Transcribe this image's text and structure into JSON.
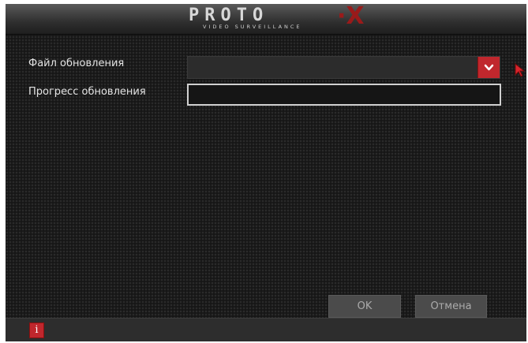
{
  "header": {
    "logo_text": "PROTO",
    "logo_sub": "VIDEO SURVEILLANCE",
    "logo_mark": "·X"
  },
  "form": {
    "update_file_label": "Файл обновления",
    "update_file_value": "",
    "update_progress_label": "Прогресс обновления",
    "update_progress_value": 0
  },
  "buttons": {
    "ok_label": "OK",
    "cancel_label": "Отмена"
  },
  "icons": {
    "dropdown": "chevron-down-icon",
    "cursor": "mouse-pointer-icon",
    "info": "info-icon"
  },
  "footer": {
    "info_glyph": "i"
  },
  "colors": {
    "accent": "#c0272d",
    "background": "#161616",
    "button": "#4b4b4b",
    "text": "#e3e3e3"
  }
}
